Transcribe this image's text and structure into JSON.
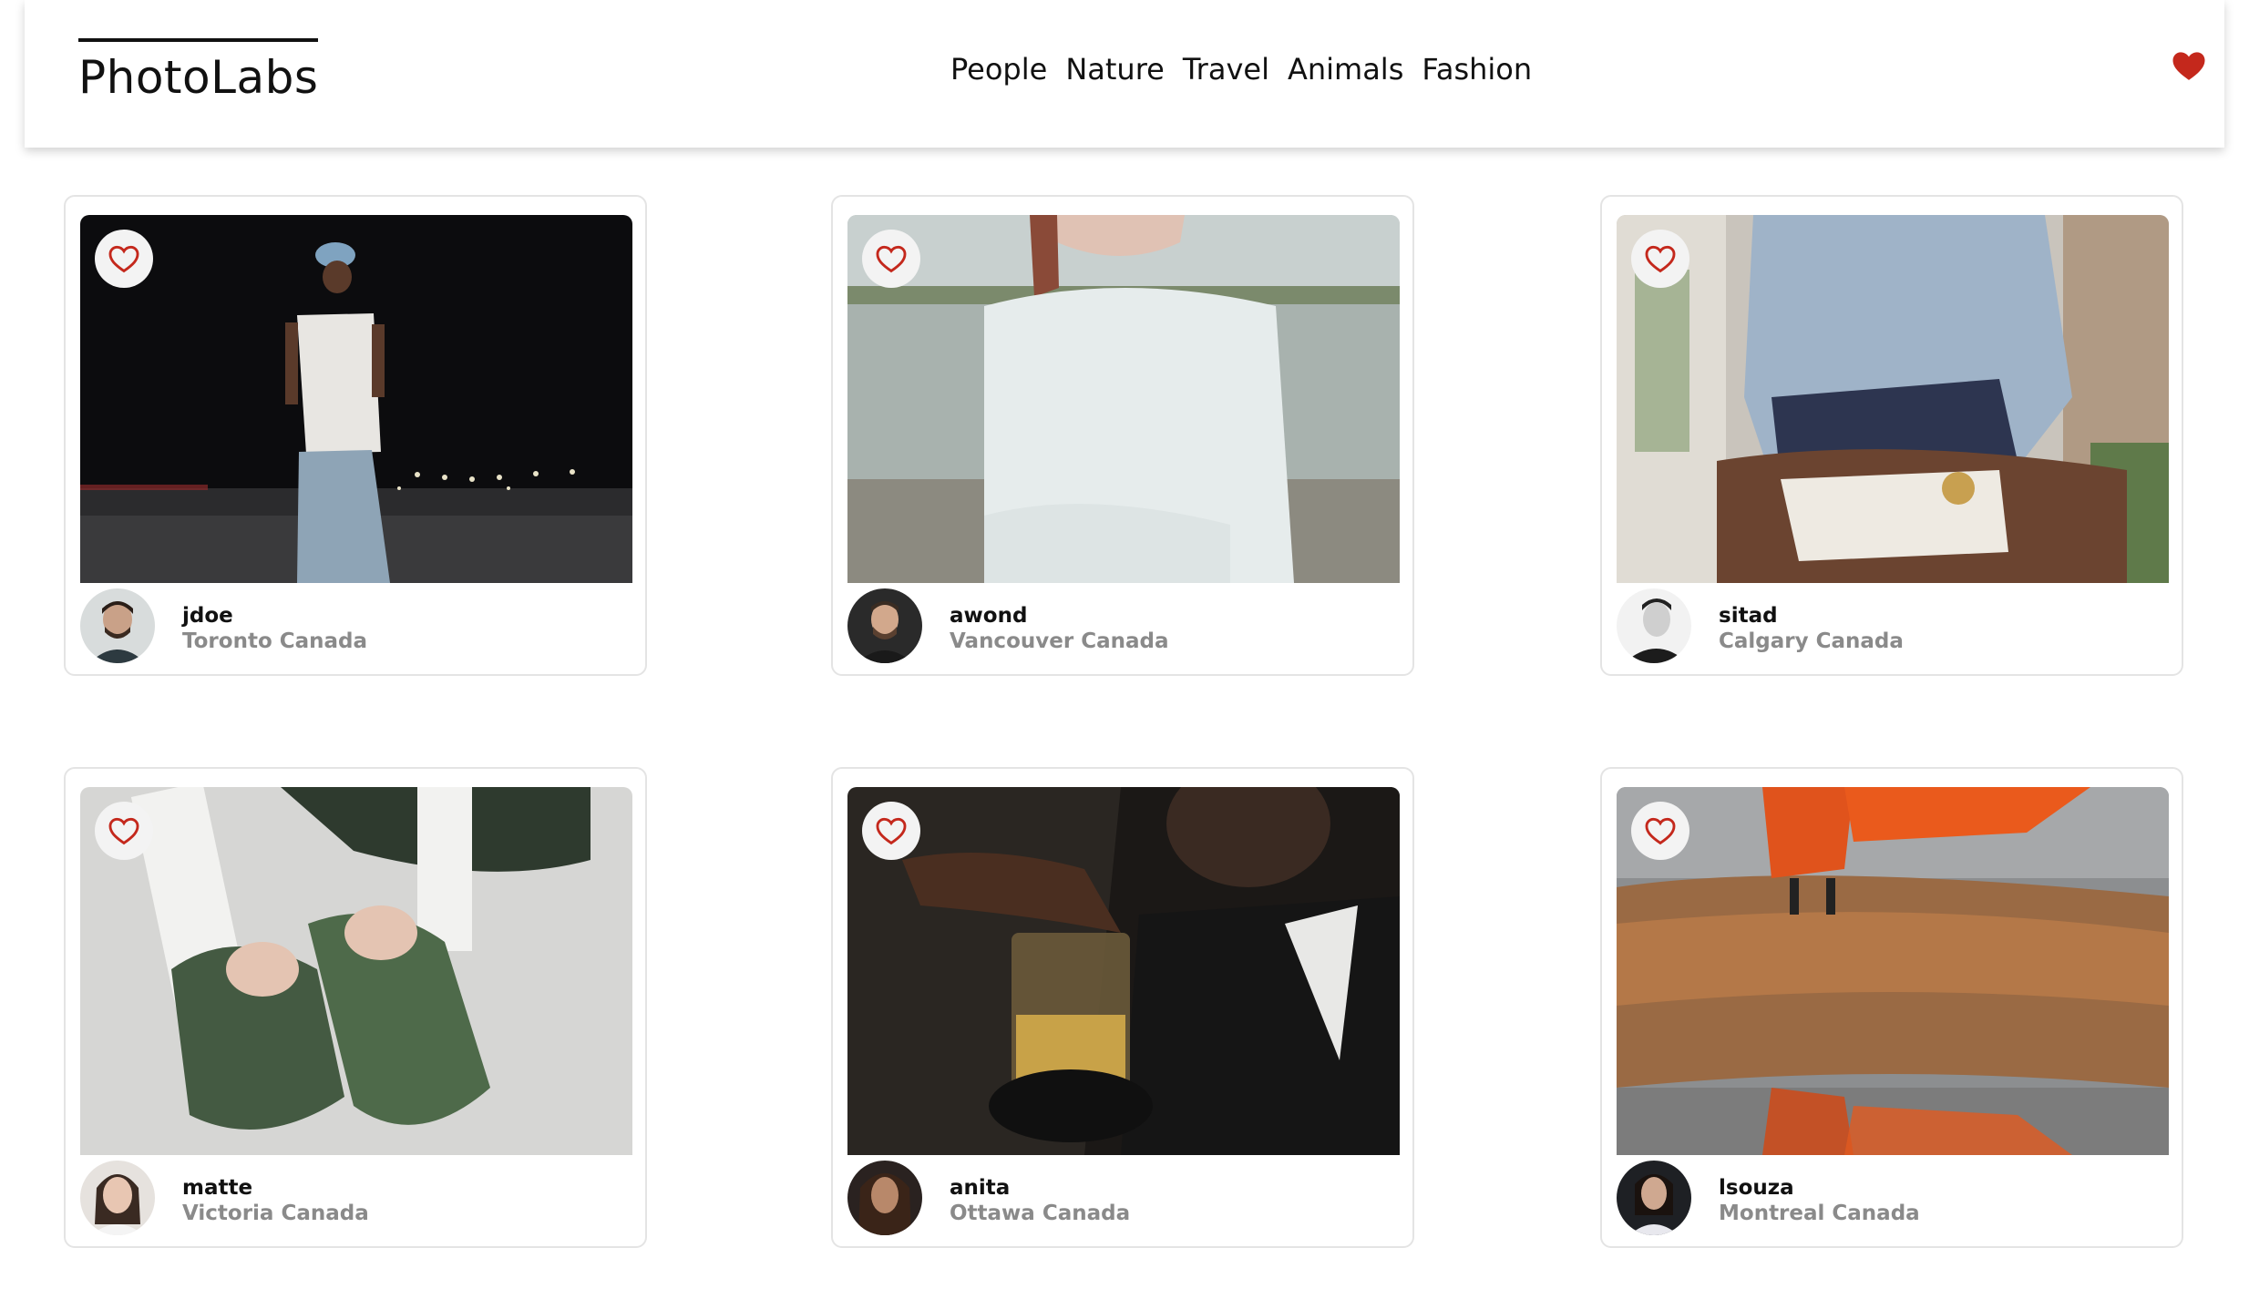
{
  "app": {
    "title": "PhotoLabs"
  },
  "topics": [
    "People",
    "Nature",
    "Travel",
    "Animals",
    "Fashion"
  ],
  "colors": {
    "heart": "#c4281c",
    "muted": "#8a8a8a",
    "border": "#e4e4e4"
  },
  "photos": [
    {
      "username": "jdoe",
      "location": "Toronto Canada"
    },
    {
      "username": "awond",
      "location": "Vancouver Canada"
    },
    {
      "username": "sitad",
      "location": "Calgary Canada"
    },
    {
      "username": "matte",
      "location": "Victoria Canada"
    },
    {
      "username": "anita",
      "location": "Ottawa Canada"
    },
    {
      "username": "lsouza",
      "location": "Montreal Canada"
    }
  ]
}
